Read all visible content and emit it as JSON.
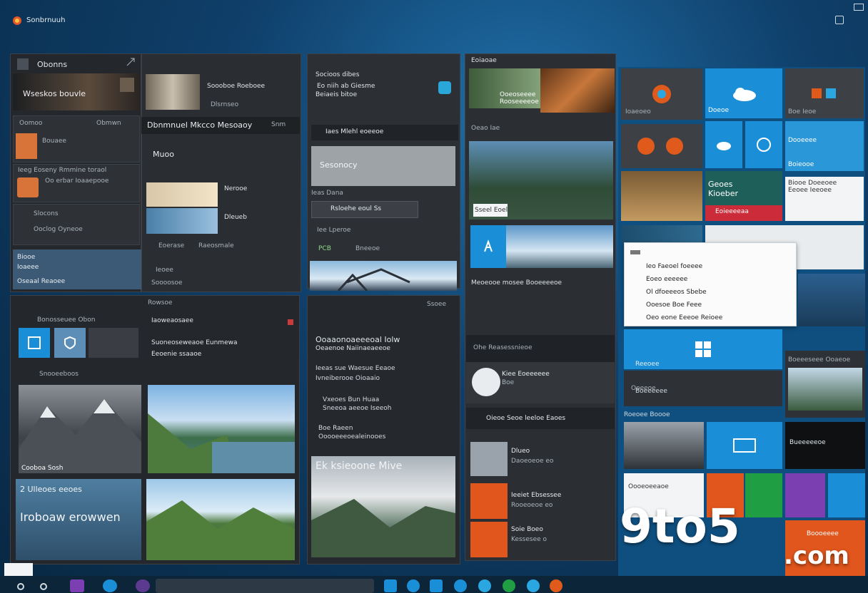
{
  "window": {
    "title": "Sonbrnuuh"
  },
  "col1": {
    "header": "Obonns",
    "row1": "Wseskos bouvle",
    "item_a": {
      "title": "Oomoo",
      "label1": "Obmwn",
      "label2": "Bouaee"
    },
    "item_b": {
      "line1": "Ieeg Eoseny Rmmine toraol",
      "line2": "Oo erbar Ioaaepooe"
    },
    "item_c": {
      "line1": "Slocons",
      "line2": "Ooclog Oyneoe"
    },
    "blue": {
      "line1": "Biooe",
      "line2": "Ioaeee",
      "line3": "Oseaal Reaoee"
    },
    "section_label": "Rowsoe",
    "card_header": "Bonosseuee Obon",
    "card_sub": "Snooeeboos",
    "card_caption": "Cooboa Sosh",
    "big_card": {
      "line1": "2 Ulleoes eeoes",
      "line2": "Iroboaw erowwen"
    }
  },
  "col2": {
    "top_text": "Soooboe Roeboee",
    "top_sub": "Dlsrnseo",
    "header": "Dbnmnuel Mkcco Mesoaoy",
    "header_right": "Snm",
    "sub_title": "Muoo",
    "list1": "Nerooe",
    "list2": "Dleueb",
    "caption1": "Eoerase",
    "caption2": "Raeosmale",
    "mid1": "Ieoee",
    "mid2": "Soooosoe",
    "text_block1": "Iaoweaosaee",
    "text_block2": "Suoneoseweaoe Eunmewa",
    "text_block3": "Eeoenie ssaaoe"
  },
  "col3": {
    "top1": "Socioos dibes",
    "top2": "Eo niih ab Giesme",
    "top3": "Beiaeis bitoe",
    "header": "Iaes Mlehl eoeeoe",
    "grey_box": "Sesonocy",
    "row_title": "Ieas Dana",
    "row_mid": "Rsloehe eoul Ss",
    "row_small": "Iee Lperoe",
    "row_code": "PCB",
    "row_code2": "Bneeoe",
    "label": "Ssoee",
    "dark_header": "Ooaaonoaeeeoal Iolw",
    "dark_sub": "Oeaenoe Naiinaeaeeoe",
    "list": [
      "Ieeas sue Waesue Eeaoe",
      "Ivneiberooe Oioaaio",
      "Vxeoes Bun Huaa",
      "Sneeoa aeeoe Iseeoh",
      "Boe Raeen",
      "Ooooeeeoealeinooes"
    ],
    "bottom_title": "Ek ksieoone Mive"
  },
  "col4": {
    "header": "Eoiaoae",
    "top_text1": "Ooeoseeee",
    "top_text2": "Rooseeeeoe",
    "section": "Oeao Iae",
    "caption": "Sseel Eoel",
    "blue_caption": "Meoeooe mosee Booeeeeoe",
    "dim_label": "Ohe Reasessnieoe",
    "dim_card": "Kiee Eoeeeeee",
    "dim_card_sub": "Boe",
    "playlist": "Oieoe Seoe leeloe Eaoes",
    "list": [
      {
        "title": "Dlueo",
        "sub": "Daoeoeoe eo"
      },
      {
        "title": "Ieeiet Ebsessee",
        "sub": "Rooeoeoe eo"
      },
      {
        "title": "Soie Boeo",
        "sub": "Kessesee o"
      }
    ]
  },
  "start": {
    "tiles": {
      "t1": "Ioaeoeo",
      "t2": "Doeoe",
      "t3": "Boe Ieoe",
      "t5": "Dooeeee",
      "t6": "Boieooe",
      "t7": "Geoes\nKioeber",
      "t8": "Eoieeeeaa",
      "t9": "Biooe Doeeoee\nEeoee Ieeoee",
      "t10": "Ooeeoe",
      "t11": "Boeeeseee Ooaeoe",
      "t12": "Bueeeeeoe",
      "t13": "Oooeoeeaoe",
      "t14": "Boeeeeee",
      "t15": "Reeoee",
      "t16": "Boooeeee"
    },
    "section": "Roeoee Boooe",
    "menu": [
      "Ieo Faeoel foeeee",
      "Eoeo eeeeee",
      "Ol dfoeeeos Sbebe",
      "Ooesoe Boe Feee",
      "Oeo eone Eeeoe Reioee"
    ]
  },
  "brand": {
    "text": "9to5",
    "suffix": ".com"
  },
  "colors": {
    "accent_blue": "#1a8fd8",
    "tile_blue": "#0e7ac4",
    "orange": "#e05b1b",
    "red": "#e0332a",
    "green": "#1f9e43",
    "purple": "#7b3fb2"
  },
  "taskbar": {
    "icons": [
      "edge-icon",
      "mail-icon",
      "store-icon",
      "photos-icon",
      "chrome-icon",
      "news-icon",
      "settings-icon"
    ]
  }
}
